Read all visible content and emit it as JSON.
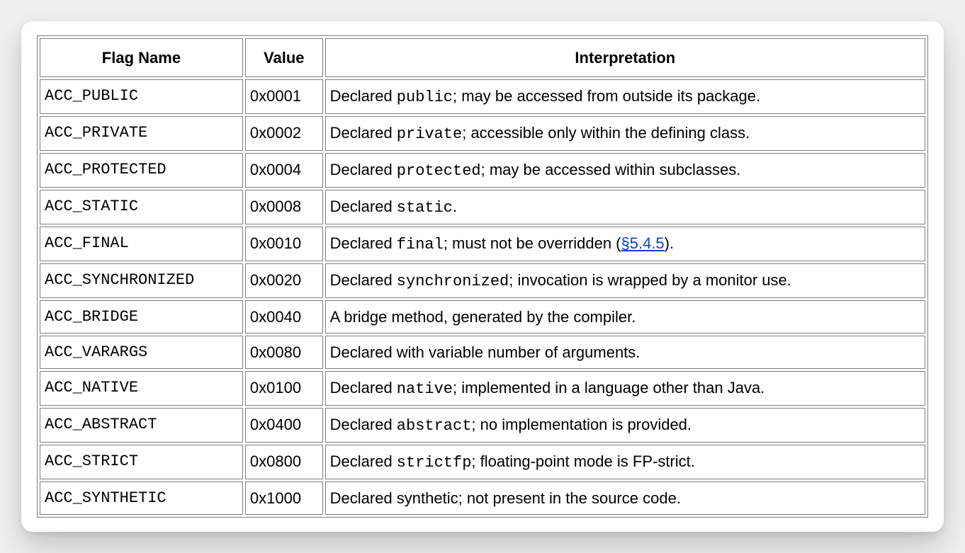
{
  "table": {
    "headers": {
      "flag_name": "Flag Name",
      "value": "Value",
      "interpretation": "Interpretation"
    },
    "rows": [
      {
        "flag": "ACC_PUBLIC",
        "value": "0x0001",
        "interp_prefix": "Declared ",
        "interp_code": "public",
        "interp_suffix": "; may be accessed from outside its package.",
        "link_text": ""
      },
      {
        "flag": "ACC_PRIVATE",
        "value": "0x0002",
        "interp_prefix": "Declared ",
        "interp_code": "private",
        "interp_suffix": "; accessible only within the defining class.",
        "link_text": ""
      },
      {
        "flag": "ACC_PROTECTED",
        "value": "0x0004",
        "interp_prefix": "Declared ",
        "interp_code": "protected",
        "interp_suffix": "; may be accessed within subclasses.",
        "link_text": ""
      },
      {
        "flag": "ACC_STATIC",
        "value": "0x0008",
        "interp_prefix": "Declared ",
        "interp_code": "static",
        "interp_suffix": ".",
        "link_text": ""
      },
      {
        "flag": "ACC_FINAL",
        "value": "0x0010",
        "interp_prefix": "Declared ",
        "interp_code": "final",
        "interp_suffix": "; must not be overridden (",
        "link_text": "§5.4.5",
        "interp_tail": ")."
      },
      {
        "flag": "ACC_SYNCHRONIZED",
        "value": "0x0020",
        "interp_prefix": "Declared ",
        "interp_code": "synchronized",
        "interp_suffix": "; invocation is wrapped by a monitor use.",
        "link_text": ""
      },
      {
        "flag": "ACC_BRIDGE",
        "value": "0x0040",
        "interp_prefix": "A bridge method, generated by the compiler.",
        "interp_code": "",
        "interp_suffix": "",
        "link_text": ""
      },
      {
        "flag": "ACC_VARARGS",
        "value": "0x0080",
        "interp_prefix": "Declared with variable number of arguments.",
        "interp_code": "",
        "interp_suffix": "",
        "link_text": ""
      },
      {
        "flag": "ACC_NATIVE",
        "value": "0x0100",
        "interp_prefix": "Declared ",
        "interp_code": "native",
        "interp_suffix": "; implemented in a language other than Java.",
        "link_text": ""
      },
      {
        "flag": "ACC_ABSTRACT",
        "value": "0x0400",
        "interp_prefix": "Declared ",
        "interp_code": "abstract",
        "interp_suffix": "; no implementation is provided.",
        "link_text": ""
      },
      {
        "flag": "ACC_STRICT",
        "value": "0x0800",
        "interp_prefix": "Declared ",
        "interp_code": "strictfp",
        "interp_suffix": "; floating-point mode is FP-strict.",
        "link_text": ""
      },
      {
        "flag": "ACC_SYNTHETIC",
        "value": "0x1000",
        "interp_prefix": "Declared synthetic; not present in the source code.",
        "interp_code": "",
        "interp_suffix": "",
        "link_text": ""
      }
    ]
  }
}
